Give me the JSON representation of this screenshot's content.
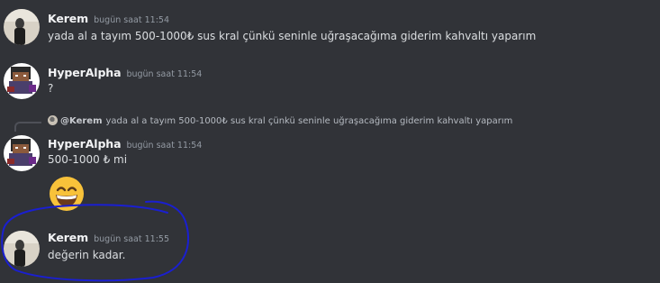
{
  "messages": [
    {
      "username": "Kerem",
      "timestamp": "bugün saat 11:54",
      "text": "yada al a tayım 500-1000₺ sus kral çünkü seninle uğraşacağıma giderim kahvaltı yaparım"
    },
    {
      "username": "HyperAlpha",
      "timestamp": "bugün saat 11:54",
      "text": "?"
    },
    {
      "reply": {
        "username": "@Kerem",
        "text": "yada al a tayım 500-1000₺ sus kral çünkü seninle uğraşacağıma giderim kahvaltı yaparım"
      },
      "username": "HyperAlpha",
      "timestamp": "bugün saat 11:54",
      "text": "500-1000 ₺ mi",
      "emoji": "grinning-face-with-smiling-eyes"
    },
    {
      "username": "Kerem",
      "timestamp": "bugün saat 11:55",
      "text": "değerin kadar."
    }
  ],
  "colors": {
    "background": "#313338",
    "username": "#f2f3f5",
    "timestamp": "#949ba4",
    "text": "#dbdee1",
    "annotation": "#1a1fd1"
  }
}
